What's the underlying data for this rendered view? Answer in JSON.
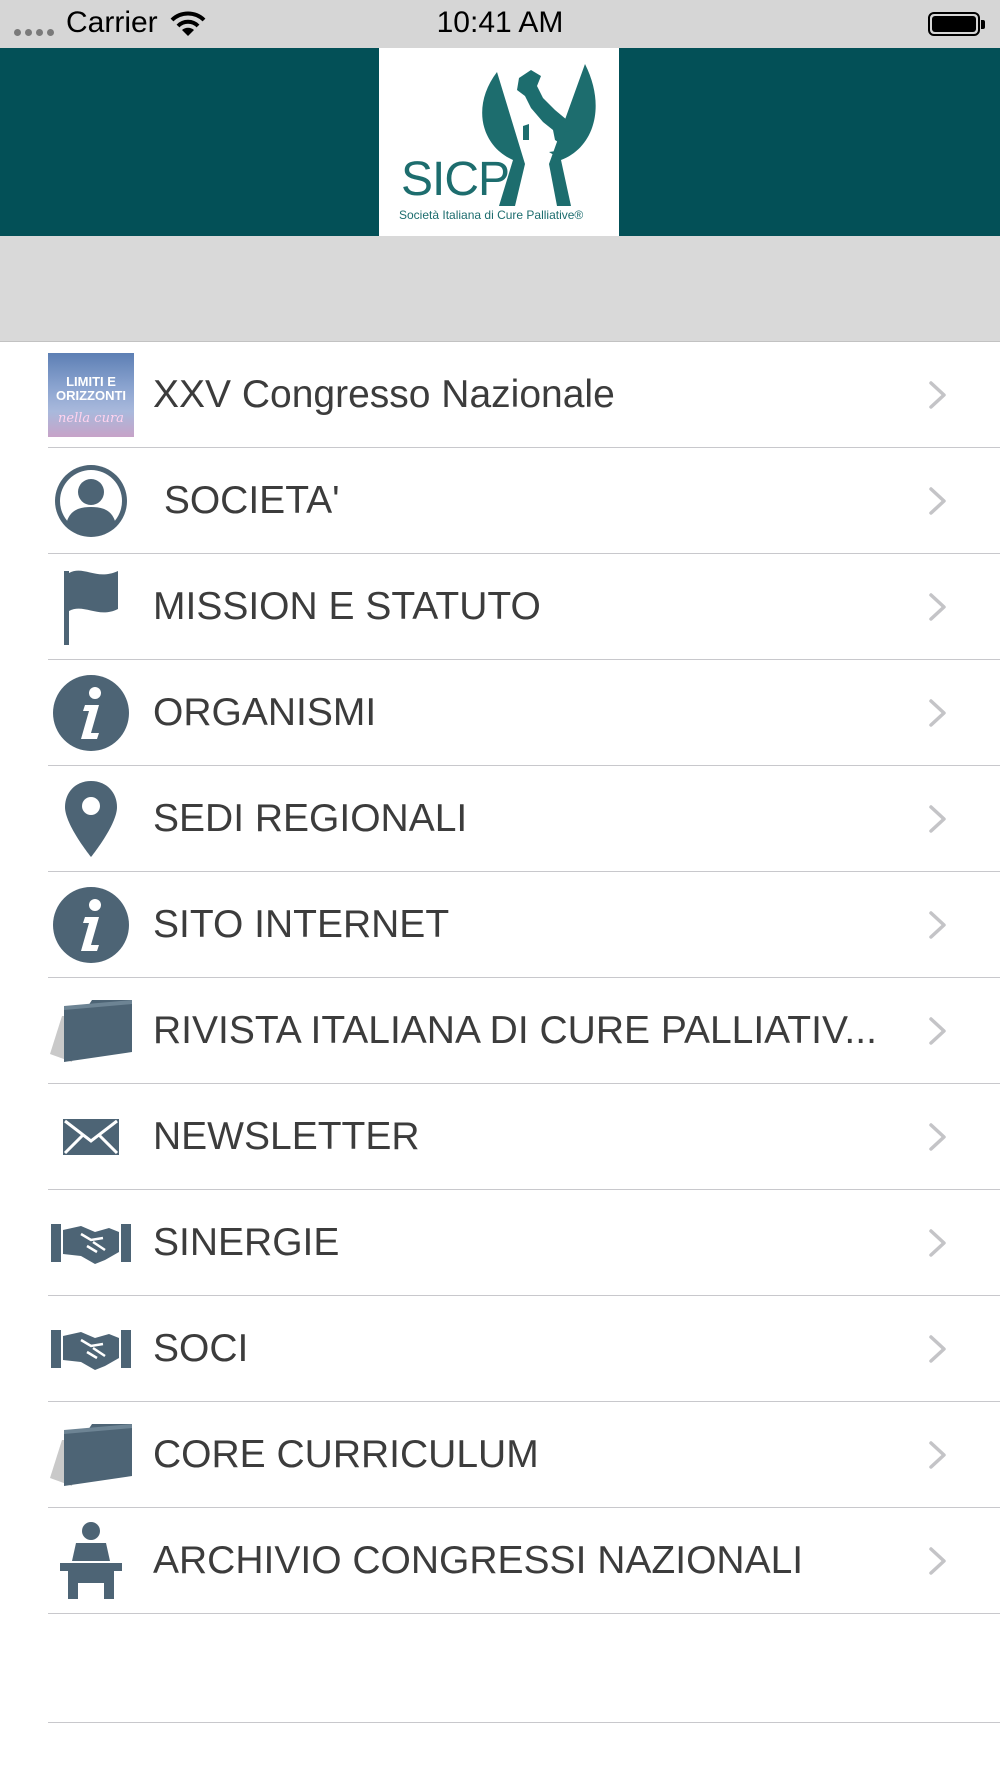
{
  "status_bar": {
    "carrier": "Carrier",
    "time": "10:41 AM"
  },
  "header": {
    "logo_name": "SICP",
    "logo_subtitle": "Società Italiana di Cure Palliative®",
    "background_color": "#035057"
  },
  "menu": {
    "items": [
      {
        "label": "XXV Congresso Nazionale",
        "icon": "congress-banner-image",
        "image_text": "LIMITI E ORIZZONTI",
        "image_subtext": "nella cura"
      },
      {
        "label": " SOCIETA'",
        "icon": "person-icon"
      },
      {
        "label": "MISSION E STATUTO",
        "icon": "flag-icon"
      },
      {
        "label": "ORGANISMI",
        "icon": "info-icon"
      },
      {
        "label": "SEDI REGIONALI",
        "icon": "map-pin-icon"
      },
      {
        "label": "SITO INTERNET",
        "icon": "info-icon"
      },
      {
        "label": "RIVISTA ITALIANA DI CURE PALLIATIV...",
        "icon": "folder-icon"
      },
      {
        "label": "NEWSLETTER",
        "icon": "envelope-icon"
      },
      {
        "label": "SINERGIE",
        "icon": "handshake-icon"
      },
      {
        "label": "SOCI",
        "icon": "handshake-icon"
      },
      {
        "label": "CORE CURRICULUM",
        "icon": "folder-icon"
      },
      {
        "label": "ARCHIVIO CONGRESSI NAZIONALI",
        "icon": "speaker-podium-icon"
      }
    ]
  },
  "colors": {
    "icon": "#4d6475",
    "text": "#3c3c3c",
    "chevron": "#c4c4c7"
  }
}
